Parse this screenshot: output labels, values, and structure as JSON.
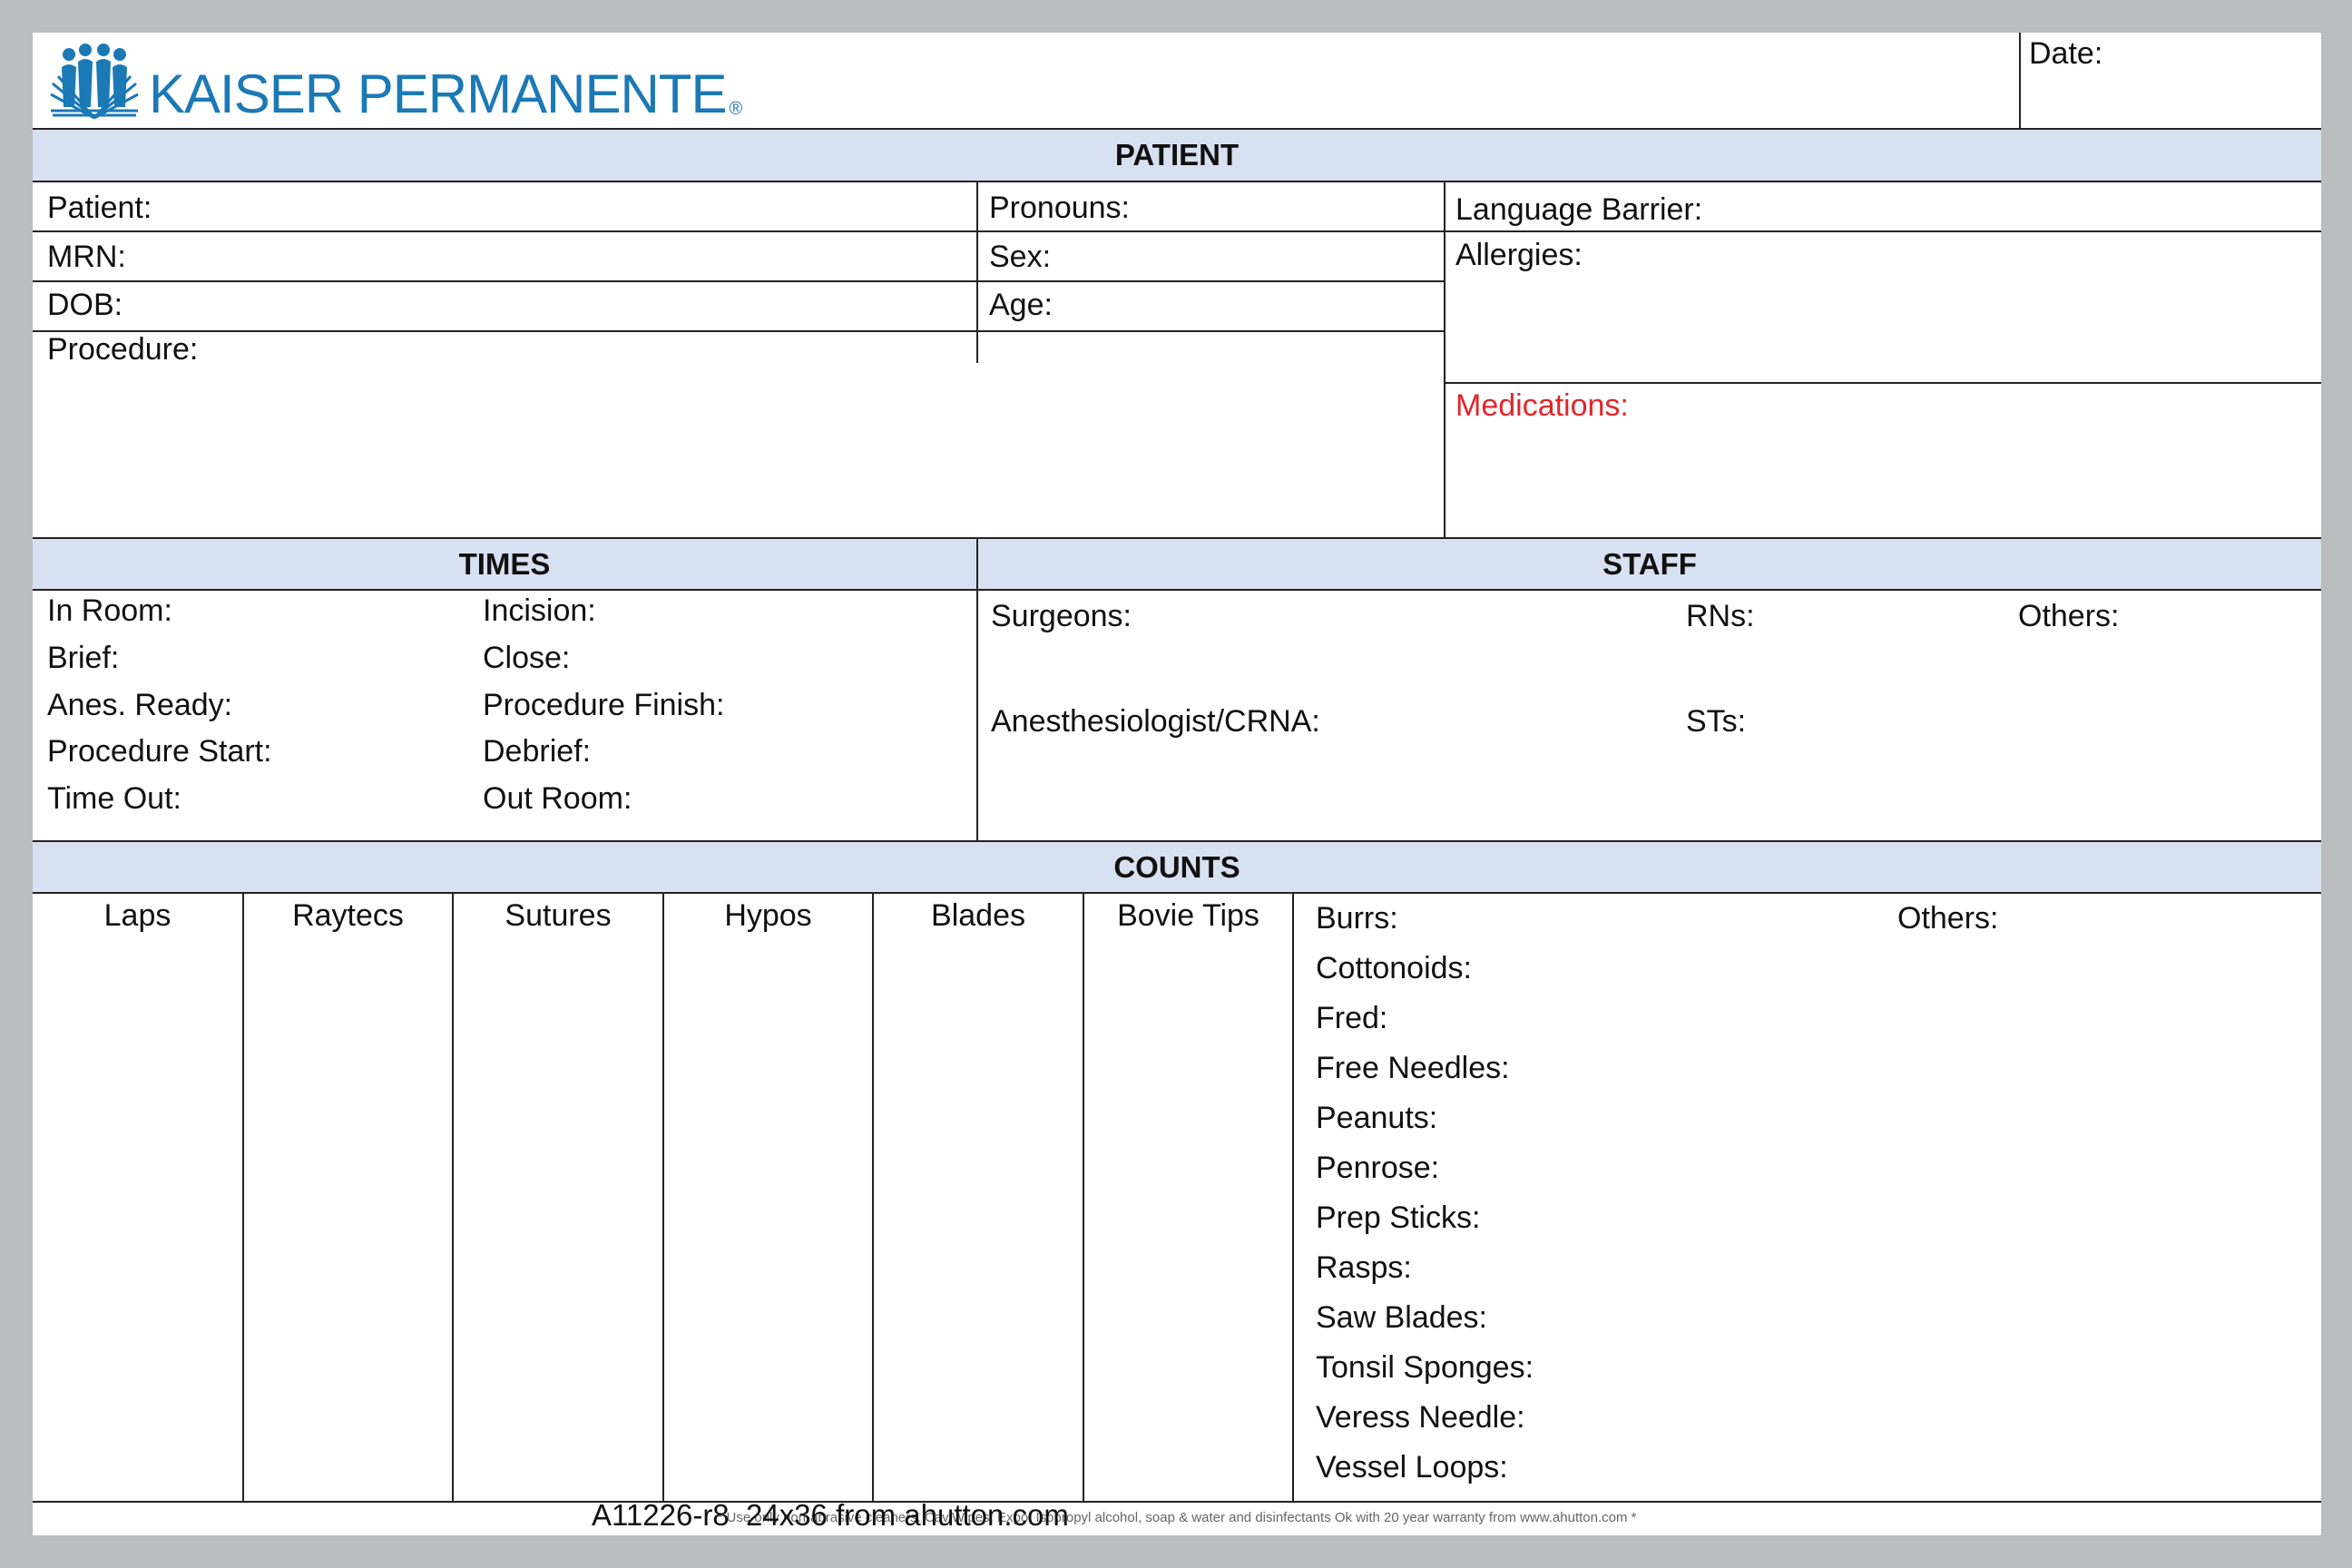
{
  "header": {
    "brand": "KAISER PERMANENTE",
    "registered_mark": "®",
    "date_label": "Date:",
    "logo_icon": "kaiser-permanente-logo-icon",
    "brand_color": "#1b79b6"
  },
  "patient": {
    "section_title": "PATIENT",
    "patient_label": "Patient:",
    "mrn_label": "MRN:",
    "dob_label": "DOB:",
    "procedure_label": "Procedure:",
    "pronouns_label": "Pronouns:",
    "sex_label": "Sex:",
    "age_label": "Age:",
    "language_barrier_label": "Language Barrier:",
    "allergies_label": "Allergies:",
    "medications_label": "Medications:",
    "medications_color": "#e0262b"
  },
  "times": {
    "section_title": "TIMES",
    "in_room": "In Room:",
    "brief": "Brief:",
    "anes_ready": "Anes. Ready:",
    "procedure_start": "Procedure Start:",
    "time_out": "Time Out:",
    "incision": "Incision:",
    "close": "Close:",
    "procedure_finish": "Procedure Finish:",
    "debrief": "Debrief:",
    "out_room": "Out Room:"
  },
  "staff": {
    "section_title": "STAFF",
    "surgeons": "Surgeons:",
    "rns": "RNs:",
    "others": "Others:",
    "anesthesiologist": "Anesthesiologist/CRNA:",
    "sts": "STs:"
  },
  "counts": {
    "section_title": "COUNTS",
    "columns": [
      "Laps",
      "Raytecs",
      "Sutures",
      "Hypos",
      "Blades",
      "Bovie Tips"
    ],
    "items": [
      "Burrs:",
      "Cottonoids:",
      "Fred:",
      "Free Needles:",
      "Peanuts:",
      "Penrose:",
      "Prep Sticks:",
      "Rasps:",
      "Saw Blades:",
      "Tonsil Sponges:",
      "Veress Needle:",
      "Vessel Loops:"
    ],
    "others": "Others:"
  },
  "footer": {
    "note": "* Use only non-abrasive cleaners. CaviWipes, Expo, Isopropyl alcohol, soap & water and disinfectants Ok with 20 year warranty from www.ahutton.com *",
    "product_id": "A11226-r8  24x36 from ahutton.com"
  },
  "colors": {
    "band_fill": "#d8e1f1",
    "frame": "#bbbcbe"
  }
}
